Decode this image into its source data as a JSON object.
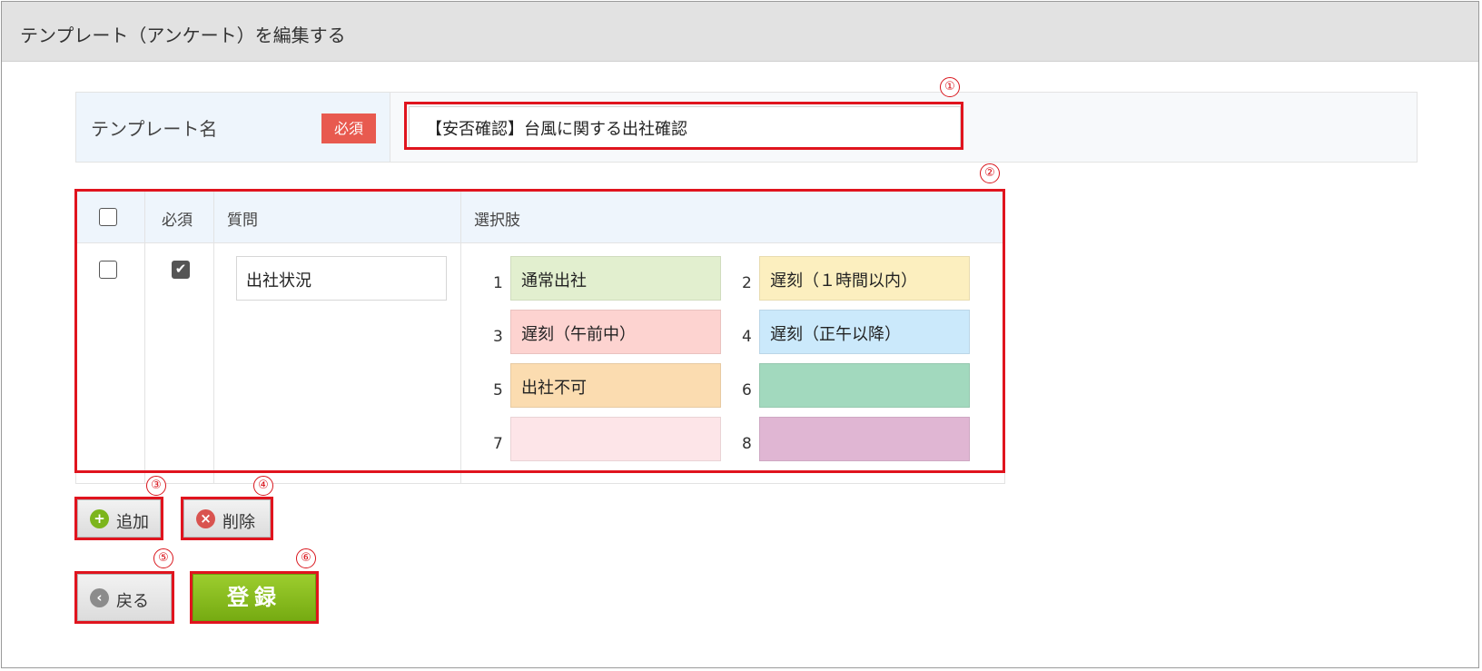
{
  "window": {
    "title": "テンプレート（アンケート）を編集する"
  },
  "callouts": [
    "①",
    "②",
    "③",
    "④",
    "⑤",
    "⑥"
  ],
  "template_name": {
    "label": "テンプレート名",
    "required_badge": "必須",
    "value": "【安否確認】台風に関する出社確認"
  },
  "question_table": {
    "headers": {
      "required": "必須",
      "question": "質問",
      "choices": "選択肢"
    },
    "row": {
      "selected": false,
      "required": true,
      "required_mark": "✔",
      "question": "出社状況",
      "options": [
        {
          "num": "1",
          "text": "通常出社",
          "color": "#e2efcf"
        },
        {
          "num": "2",
          "text": "遅刻（１時間以内）",
          "color": "#fcefbf"
        },
        {
          "num": "3",
          "text": "遅刻（午前中）",
          "color": "#fdd3d0"
        },
        {
          "num": "4",
          "text": "遅刻（正午以降）",
          "color": "#cbe9fb"
        },
        {
          "num": "5",
          "text": "出社不可",
          "color": "#fbdcb0"
        },
        {
          "num": "6",
          "text": "",
          "color": "#a2d9be"
        },
        {
          "num": "7",
          "text": "",
          "color": "#fde5e8"
        },
        {
          "num": "8",
          "text": "",
          "color": "#e0b6d3"
        }
      ]
    }
  },
  "buttons": {
    "add": {
      "label": "追加",
      "icon": "plus-circle-icon",
      "icon_color": "#7cb51c"
    },
    "delete": {
      "label": "削除",
      "icon": "x-circle-icon",
      "icon_color": "#d9534f"
    },
    "back": {
      "label": "戻る",
      "icon": "chevron-left-circle-icon",
      "icon_color": "#8c8c8c"
    },
    "register": {
      "label": "登録"
    }
  },
  "colors": {
    "highlight_border": "#e0141e",
    "register_green": "#86bd1c"
  }
}
